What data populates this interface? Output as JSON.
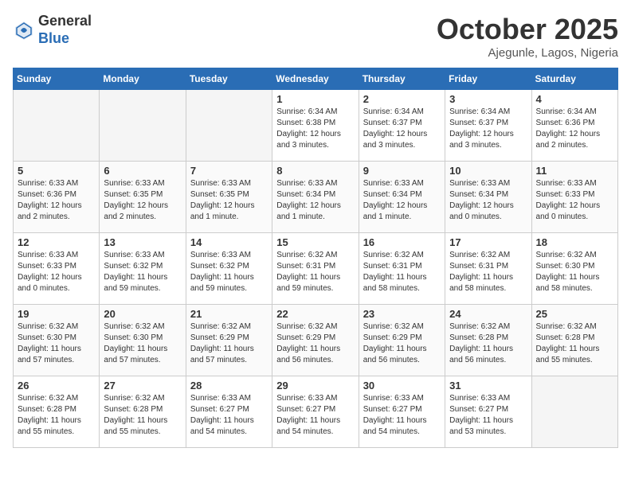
{
  "header": {
    "logo_line1": "General",
    "logo_line2": "Blue",
    "month_title": "October 2025",
    "location": "Ajegunle, Lagos, Nigeria"
  },
  "days_of_week": [
    "Sunday",
    "Monday",
    "Tuesday",
    "Wednesday",
    "Thursday",
    "Friday",
    "Saturday"
  ],
  "weeks": [
    [
      {
        "day": "",
        "info": ""
      },
      {
        "day": "",
        "info": ""
      },
      {
        "day": "",
        "info": ""
      },
      {
        "day": "1",
        "info": "Sunrise: 6:34 AM\nSunset: 6:38 PM\nDaylight: 12 hours\nand 3 minutes."
      },
      {
        "day": "2",
        "info": "Sunrise: 6:34 AM\nSunset: 6:37 PM\nDaylight: 12 hours\nand 3 minutes."
      },
      {
        "day": "3",
        "info": "Sunrise: 6:34 AM\nSunset: 6:37 PM\nDaylight: 12 hours\nand 3 minutes."
      },
      {
        "day": "4",
        "info": "Sunrise: 6:34 AM\nSunset: 6:36 PM\nDaylight: 12 hours\nand 2 minutes."
      }
    ],
    [
      {
        "day": "5",
        "info": "Sunrise: 6:33 AM\nSunset: 6:36 PM\nDaylight: 12 hours\nand 2 minutes."
      },
      {
        "day": "6",
        "info": "Sunrise: 6:33 AM\nSunset: 6:35 PM\nDaylight: 12 hours\nand 2 minutes."
      },
      {
        "day": "7",
        "info": "Sunrise: 6:33 AM\nSunset: 6:35 PM\nDaylight: 12 hours\nand 1 minute."
      },
      {
        "day": "8",
        "info": "Sunrise: 6:33 AM\nSunset: 6:34 PM\nDaylight: 12 hours\nand 1 minute."
      },
      {
        "day": "9",
        "info": "Sunrise: 6:33 AM\nSunset: 6:34 PM\nDaylight: 12 hours\nand 1 minute."
      },
      {
        "day": "10",
        "info": "Sunrise: 6:33 AM\nSunset: 6:34 PM\nDaylight: 12 hours\nand 0 minutes."
      },
      {
        "day": "11",
        "info": "Sunrise: 6:33 AM\nSunset: 6:33 PM\nDaylight: 12 hours\nand 0 minutes."
      }
    ],
    [
      {
        "day": "12",
        "info": "Sunrise: 6:33 AM\nSunset: 6:33 PM\nDaylight: 12 hours\nand 0 minutes."
      },
      {
        "day": "13",
        "info": "Sunrise: 6:33 AM\nSunset: 6:32 PM\nDaylight: 11 hours\nand 59 minutes."
      },
      {
        "day": "14",
        "info": "Sunrise: 6:33 AM\nSunset: 6:32 PM\nDaylight: 11 hours\nand 59 minutes."
      },
      {
        "day": "15",
        "info": "Sunrise: 6:32 AM\nSunset: 6:31 PM\nDaylight: 11 hours\nand 59 minutes."
      },
      {
        "day": "16",
        "info": "Sunrise: 6:32 AM\nSunset: 6:31 PM\nDaylight: 11 hours\nand 58 minutes."
      },
      {
        "day": "17",
        "info": "Sunrise: 6:32 AM\nSunset: 6:31 PM\nDaylight: 11 hours\nand 58 minutes."
      },
      {
        "day": "18",
        "info": "Sunrise: 6:32 AM\nSunset: 6:30 PM\nDaylight: 11 hours\nand 58 minutes."
      }
    ],
    [
      {
        "day": "19",
        "info": "Sunrise: 6:32 AM\nSunset: 6:30 PM\nDaylight: 11 hours\nand 57 minutes."
      },
      {
        "day": "20",
        "info": "Sunrise: 6:32 AM\nSunset: 6:30 PM\nDaylight: 11 hours\nand 57 minutes."
      },
      {
        "day": "21",
        "info": "Sunrise: 6:32 AM\nSunset: 6:29 PM\nDaylight: 11 hours\nand 57 minutes."
      },
      {
        "day": "22",
        "info": "Sunrise: 6:32 AM\nSunset: 6:29 PM\nDaylight: 11 hours\nand 56 minutes."
      },
      {
        "day": "23",
        "info": "Sunrise: 6:32 AM\nSunset: 6:29 PM\nDaylight: 11 hours\nand 56 minutes."
      },
      {
        "day": "24",
        "info": "Sunrise: 6:32 AM\nSunset: 6:28 PM\nDaylight: 11 hours\nand 56 minutes."
      },
      {
        "day": "25",
        "info": "Sunrise: 6:32 AM\nSunset: 6:28 PM\nDaylight: 11 hours\nand 55 minutes."
      }
    ],
    [
      {
        "day": "26",
        "info": "Sunrise: 6:32 AM\nSunset: 6:28 PM\nDaylight: 11 hours\nand 55 minutes."
      },
      {
        "day": "27",
        "info": "Sunrise: 6:32 AM\nSunset: 6:28 PM\nDaylight: 11 hours\nand 55 minutes."
      },
      {
        "day": "28",
        "info": "Sunrise: 6:33 AM\nSunset: 6:27 PM\nDaylight: 11 hours\nand 54 minutes."
      },
      {
        "day": "29",
        "info": "Sunrise: 6:33 AM\nSunset: 6:27 PM\nDaylight: 11 hours\nand 54 minutes."
      },
      {
        "day": "30",
        "info": "Sunrise: 6:33 AM\nSunset: 6:27 PM\nDaylight: 11 hours\nand 54 minutes."
      },
      {
        "day": "31",
        "info": "Sunrise: 6:33 AM\nSunset: 6:27 PM\nDaylight: 11 hours\nand 53 minutes."
      },
      {
        "day": "",
        "info": ""
      }
    ]
  ]
}
